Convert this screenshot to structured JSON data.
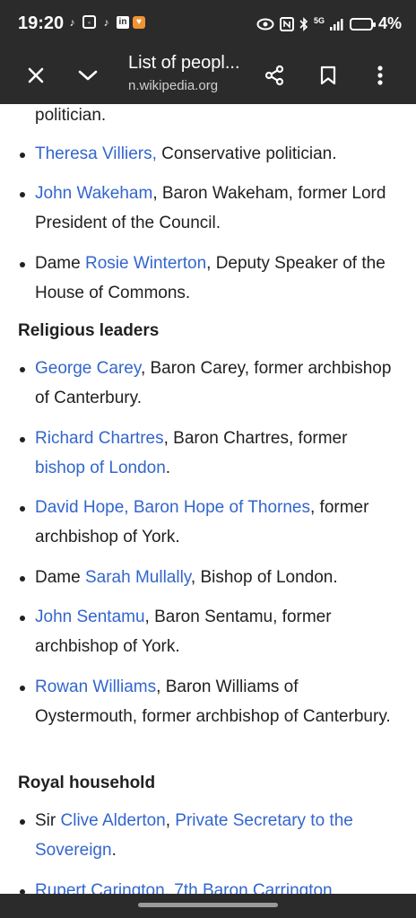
{
  "status_bar": {
    "time": "19:20",
    "battery": "4%",
    "network": "5G"
  },
  "toolbar": {
    "title": "List of peopl...",
    "url": "n.wikipedia.org",
    "icons": [
      "close-icon",
      "chevron-down-icon",
      "share-icon",
      "bookmark-icon",
      "more-vert-icon"
    ]
  },
  "article": {
    "top_fragment": "politician.",
    "items_politicians": [
      {
        "link": "Theresa Villiers,",
        "text": " Conservative politician."
      },
      {
        "link": "John Wakeham",
        "text": ", Baron Wakeham, former Lord President of the Council."
      },
      {
        "prefix": "Dame ",
        "link": "Rosie Winterton",
        "text": ", Deputy Speaker of the House of Commons."
      }
    ],
    "heading_religious": "Religious leaders",
    "items_religious": [
      {
        "link": "George Carey",
        "text": ", Baron Carey, former archbishop of Canterbury."
      },
      {
        "link": "Richard Chartres",
        "text": ", Baron Chartres, former ",
        "link2": "bishop of London",
        "text2": "."
      },
      {
        "link": "David Hope, Baron Hope of Thornes",
        "text": ", former archbishop of York."
      },
      {
        "prefix": "Dame ",
        "link": "Sarah Mullally",
        "text": ", Bishop of London."
      },
      {
        "link": "John Sentamu",
        "text": ", Baron Sentamu, former archbishop of York."
      },
      {
        "link": "Rowan Williams",
        "text": ", Baron Williams of Oystermouth, former archbishop of Canterbury."
      }
    ],
    "heading_royal": "Royal household",
    "items_royal": [
      {
        "prefix": "Sir ",
        "link": "Clive Alderton",
        "text": ", ",
        "link2": "Private Secretary to the Sovereign",
        "text2": "."
      },
      {
        "link": "Rupert Carington, 7th Baron Carrington"
      }
    ]
  }
}
